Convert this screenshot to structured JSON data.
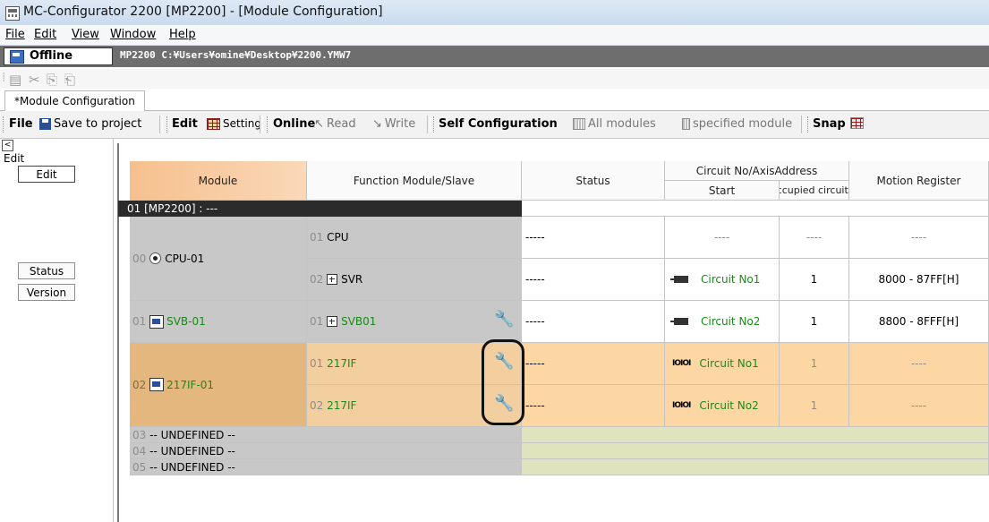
{
  "window": {
    "title": "MC-Configurator 2200 [MP2200] - [Module Configuration]"
  },
  "menu": {
    "file": "File",
    "edit": "Edit",
    "view": "View",
    "window": "Window",
    "help": "Help"
  },
  "project": {
    "mode": "Offline",
    "path": "MP2200  C:¥Users¥omine¥Desktop¥2200.YMW7"
  },
  "tab": {
    "label": "*Module Configuration"
  },
  "toolbar": {
    "file": "File",
    "save": "Save to project",
    "edit": "Edit",
    "setting": "Setting",
    "online": "Online",
    "read": "Read",
    "write": "Write",
    "selfconfig": "Self Configuration",
    "allmodules": "All modules",
    "specified": "specified module",
    "snap": "Snap"
  },
  "left_pane": {
    "collapse": "<",
    "title": "Edit",
    "buttons": [
      "Edit",
      "Status",
      "Version"
    ]
  },
  "grid": {
    "headers": {
      "module": "Module",
      "function": "Function Module/Slave",
      "status": "Status",
      "circuit_group": "Circuit No/AxisAddress",
      "start": "Start",
      "occupied": "Occupied circuits",
      "motion": "Motion Register"
    },
    "group_row": "01 [MP2200] : ---",
    "rows": [
      {
        "slot": "00",
        "module": "CPU-01",
        "subs": [
          {
            "no": "01",
            "name": "CPU",
            "status": "-----",
            "start": "----",
            "occupied": "----",
            "motion": "----"
          },
          {
            "no": "02",
            "name": "SVR",
            "status": "-----",
            "start": "Circuit No1",
            "occupied": "1",
            "motion": "8000 - 87FF[H]"
          }
        ]
      },
      {
        "slot": "01",
        "module": "SVB-01",
        "subs": [
          {
            "no": "01",
            "name": "SVB01",
            "status": "-----",
            "start": "Circuit No2",
            "occupied": "1",
            "motion": "8800 - 8FFF[H]"
          }
        ]
      },
      {
        "slot": "02",
        "module": "217IF-01",
        "subs": [
          {
            "no": "01",
            "name": "217IF",
            "status": "-----",
            "io": "IOIOI",
            "start": "Circuit No1",
            "occupied": "1",
            "motion": "----"
          },
          {
            "no": "02",
            "name": "217IF",
            "status": "-----",
            "io": "IOIOI",
            "start": "Circuit No2",
            "occupied": "1",
            "motion": "----"
          }
        ]
      }
    ],
    "undefined_rows": [
      {
        "slot": "03",
        "label": "-- UNDEFINED --"
      },
      {
        "slot": "04",
        "label": "-- UNDEFINED --"
      },
      {
        "slot": "05",
        "label": "-- UNDEFINED --"
      }
    ]
  }
}
